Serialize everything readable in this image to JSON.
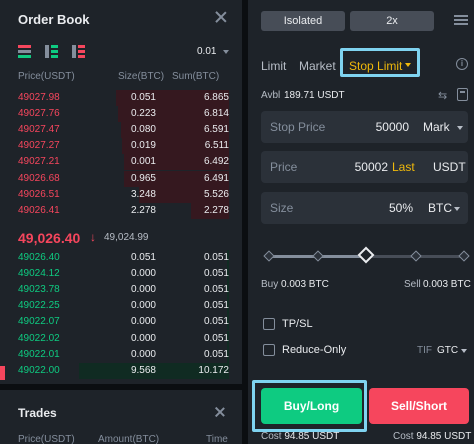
{
  "colors": {
    "green": "#0ecb81",
    "red": "#f6465d",
    "yellow": "#f0b90b",
    "highlight": "#7fd3f0"
  },
  "order_book": {
    "title": "Order Book",
    "precision": "0.01",
    "headers": {
      "price": "Price(USDT)",
      "size": "Size(BTC)",
      "sum": "Sum(BTC)"
    },
    "asks": [
      {
        "price": "49027.98",
        "size": "0.051",
        "sum": "6.865",
        "depth": 0.75
      },
      {
        "price": "49027.76",
        "size": "0.223",
        "sum": "6.814",
        "depth": 0.74
      },
      {
        "price": "49027.47",
        "size": "0.080",
        "sum": "6.591",
        "depth": 0.72
      },
      {
        "price": "49027.27",
        "size": "0.019",
        "sum": "6.511",
        "depth": 0.71
      },
      {
        "price": "49027.21",
        "size": "0.001",
        "sum": "6.492",
        "depth": 0.7
      },
      {
        "price": "49026.68",
        "size": "0.965",
        "sum": "6.491",
        "depth": 0.7
      },
      {
        "price": "49026.51",
        "size": "3.248",
        "sum": "5.526",
        "depth": 0.6
      },
      {
        "price": "49026.41",
        "size": "2.278",
        "sum": "2.278",
        "depth": 0.25
      }
    ],
    "mid": {
      "price": "49,026.40",
      "arrow": "↓",
      "mark": "49,024.99"
    },
    "bids": [
      {
        "price": "49026.40",
        "size": "0.051",
        "sum": "0.051",
        "depth": 0.01
      },
      {
        "price": "49024.12",
        "size": "0.000",
        "sum": "0.051",
        "depth": 0.01
      },
      {
        "price": "49023.78",
        "size": "0.000",
        "sum": "0.051",
        "depth": 0.01
      },
      {
        "price": "49022.25",
        "size": "0.000",
        "sum": "0.051",
        "depth": 0.01
      },
      {
        "price": "49022.07",
        "size": "0.000",
        "sum": "0.051",
        "depth": 0.01
      },
      {
        "price": "49022.02",
        "size": "0.000",
        "sum": "0.051",
        "depth": 0.01
      },
      {
        "price": "49022.01",
        "size": "0.000",
        "sum": "0.051",
        "depth": 0.01
      },
      {
        "price": "49022.00",
        "size": "9.568",
        "sum": "10.172",
        "depth": 1.0
      }
    ]
  },
  "trades": {
    "title": "Trades",
    "headers": {
      "price": "Price(USDT)",
      "amount": "Amount(BTC)",
      "time": "Time"
    }
  },
  "form": {
    "margin_mode": "Isolated",
    "leverage": "2x",
    "tabs": {
      "limit": "Limit",
      "market": "Market",
      "stop_limit": "Stop Limit"
    },
    "info_icon": "i",
    "avbl_label": "Avbl",
    "avbl_value": "189.71 USDT",
    "stop_price": {
      "label": "Stop Price",
      "value": "50000",
      "unit": "Mark"
    },
    "price": {
      "label": "Price",
      "value": "50002",
      "tag": "Last",
      "unit": "USDT"
    },
    "size": {
      "label": "Size",
      "value": "50%",
      "unit": "BTC"
    },
    "slider_percent": 50,
    "buy_label": "Buy",
    "buy_value": "0.003 BTC",
    "sell_label": "Sell",
    "sell_value": "0.003 BTC",
    "tpsl_label": "TP/SL",
    "reduce_only_label": "Reduce-Only",
    "tif_label": "TIF",
    "tif_value": "GTC",
    "buy_button": "Buy/Long",
    "sell_button": "Sell/Short",
    "cost_label": "Cost",
    "buy_cost": "94.85 USDT",
    "sell_cost": "94.85 USDT"
  }
}
